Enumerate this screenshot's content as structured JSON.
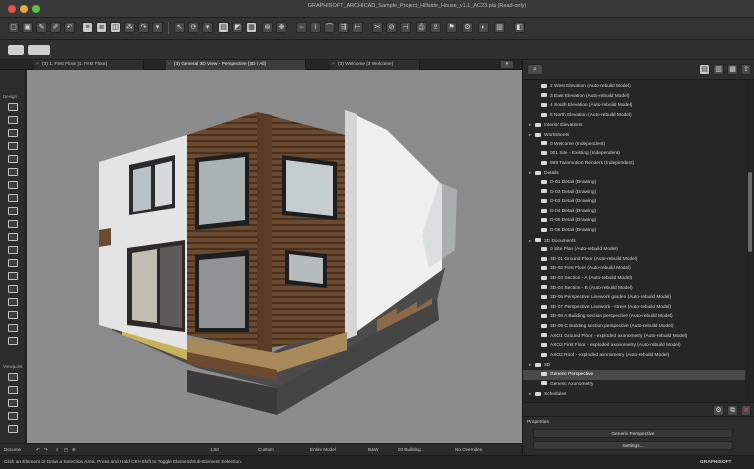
{
  "window": {
    "title": "GRAPHISOFT_ARCHICAD_Sample_Project_Hillside_House_v1.1_AC23.pla (Read-only)"
  },
  "tabs": [
    {
      "label": "(3) 1. First Floor [1. First Floor]"
    },
    {
      "label": "(3) General 3D View - Perspective [3D / All]"
    },
    {
      "label": "(3) Welcome [3 Welcome]"
    }
  ],
  "toolbox": {
    "design_label": "Design",
    "viewpoint_label": "Viewpoint",
    "document_label": "Docume"
  },
  "status_bar": {
    "scale": "1:50",
    "structure": "Custom",
    "model": "Entire Model",
    "mvo": "B&W",
    "structure2": "03 Building...",
    "overrides": "No Overrides"
  },
  "hint": {
    "text": "Click an Element or Draw a Selection Area. Press and Hold Ctrl+Shift to Toggle Element/Sub-Element Selection.",
    "brand": "GRAPHISOFT"
  },
  "navigator": {
    "items": [
      {
        "label": "2 West Elevation (Auto-rebuild Model)",
        "level": 2,
        "type": "item"
      },
      {
        "label": "3 East Elevation (Auto-rebuild Model)",
        "level": 2,
        "type": "item"
      },
      {
        "label": "4 South Elevation (Auto-rebuild Model)",
        "level": 2,
        "type": "item"
      },
      {
        "label": "5 North Elevation (Auto-rebuild Model)",
        "level": 2,
        "type": "item"
      },
      {
        "label": "Interior Elevations",
        "level": 1,
        "type": "folder"
      },
      {
        "label": "Worksheets",
        "level": 1,
        "type": "folder"
      },
      {
        "label": "0 Welcome (Independent)",
        "level": 2,
        "type": "item"
      },
      {
        "label": "001 Site - Existing (Independent)",
        "level": 2,
        "type": "item"
      },
      {
        "label": "998 Twinmotion Renders (Independent)",
        "level": 2,
        "type": "item"
      },
      {
        "label": "Details",
        "level": 1,
        "type": "folder"
      },
      {
        "label": "D-01 Detail (Drawing)",
        "level": 2,
        "type": "item"
      },
      {
        "label": "D-02 Detail (Drawing)",
        "level": 2,
        "type": "item"
      },
      {
        "label": "D-03 Detail (Drawing)",
        "level": 2,
        "type": "item"
      },
      {
        "label": "D-04 Detail (Drawing)",
        "level": 2,
        "type": "item"
      },
      {
        "label": "D-05 Detail (Drawing)",
        "level": 2,
        "type": "item"
      },
      {
        "label": "D-06 Detail (Drawing)",
        "level": 2,
        "type": "item"
      },
      {
        "label": "3D Documents",
        "level": 1,
        "type": "folder"
      },
      {
        "label": "0 Site Plan (Auto-rebuild Model)",
        "level": 2,
        "type": "item"
      },
      {
        "label": "3D-01 Ground Floor (Auto-rebuild Model)",
        "level": 2,
        "type": "item"
      },
      {
        "label": "3D-02 First Floor (Auto-rebuild Model)",
        "level": 2,
        "type": "item"
      },
      {
        "label": "3D-03 Section - A (Auto-rebuild Model)",
        "level": 2,
        "type": "item"
      },
      {
        "label": "3D-04 Section - B (Auto-rebuild Model)",
        "level": 2,
        "type": "item"
      },
      {
        "label": "3D-06 Perspective Linework garden (Auto-rebuild Model)",
        "level": 2,
        "type": "item"
      },
      {
        "label": "3D-07 Perspective Linework - street (Auto-rebuild Model)",
        "level": 2,
        "type": "item"
      },
      {
        "label": "3D-08 A Building section perspective (Auto-rebuild Model)",
        "level": 2,
        "type": "item"
      },
      {
        "label": "3D-09 C Building section perspective (Auto-rebuild Model)",
        "level": 2,
        "type": "item"
      },
      {
        "label": "AXO1 Ground Floor - exploded axonometry (Auto-rebuild Model)",
        "level": 2,
        "type": "item"
      },
      {
        "label": "AXO2 First Floor - exploded axonometry (Auto-rebuild Model)",
        "level": 2,
        "type": "item"
      },
      {
        "label": "AXO3 Roof - exploded axonometry (Auto-rebuild Model)",
        "level": 2,
        "type": "item"
      },
      {
        "label": "3D",
        "level": 1,
        "type": "folder"
      },
      {
        "label": "Generic Perspective",
        "level": 2,
        "type": "item",
        "selected": true
      },
      {
        "label": "Generic Axonometry",
        "level": 2,
        "type": "item"
      },
      {
        "label": "Schedules",
        "level": 1,
        "type": "folder"
      }
    ]
  },
  "properties": {
    "header": "Properties",
    "value": "Generic Perspective",
    "settings_button": "Settings..."
  },
  "colors": {
    "wood": "#6b4a30",
    "wall": "#ececec",
    "sky": "#8a8a8a"
  }
}
